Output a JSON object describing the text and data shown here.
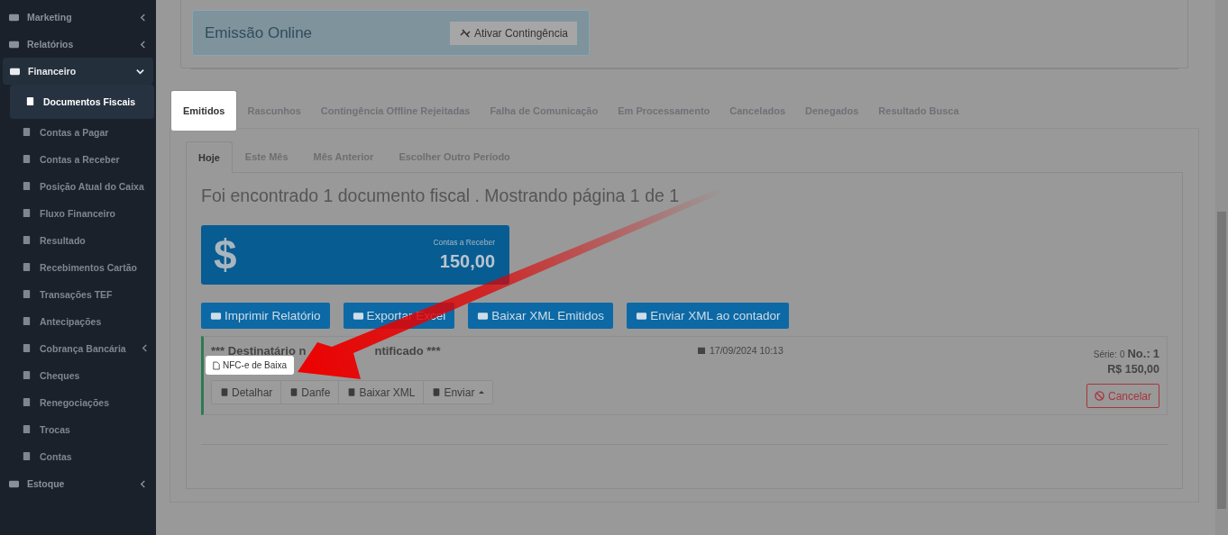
{
  "sidebar": {
    "items": [
      {
        "label": "Marketing",
        "expanded": false
      },
      {
        "label": "Relatórios",
        "expanded": false
      },
      {
        "label": "Financeiro",
        "expanded": true,
        "children": [
          {
            "label": "Documentos Fiscais",
            "kind": "link",
            "selected": true
          },
          {
            "label": "Contas a Pagar",
            "kind": "link",
            "selected": false
          },
          {
            "label": "Contas a Receber",
            "kind": "link",
            "selected": false
          },
          {
            "label": "Posição Atual do Caixa",
            "kind": "link",
            "selected": false
          },
          {
            "label": "Fluxo Financeiro",
            "kind": "link",
            "selected": false
          },
          {
            "label": "Resultado",
            "kind": "link",
            "selected": false
          },
          {
            "label": "Recebimentos Cartão",
            "kind": "link",
            "selected": false
          },
          {
            "label": "Transações TEF",
            "kind": "link",
            "selected": false
          },
          {
            "label": "Antecipações",
            "kind": "link",
            "selected": false
          },
          {
            "label": "Cobrança Bancária",
            "kind": "group",
            "selected": false,
            "expanded": false
          },
          {
            "label": "Cheques",
            "kind": "link",
            "selected": false
          },
          {
            "label": "Renegociações",
            "kind": "link",
            "selected": false
          },
          {
            "label": "Trocas",
            "kind": "link",
            "selected": false
          },
          {
            "label": "Contas",
            "kind": "link",
            "selected": false
          }
        ]
      },
      {
        "label": "Estoque",
        "expanded": false
      }
    ]
  },
  "contingency": {
    "status": "Emissão Online",
    "button": "Ativar Contingência"
  },
  "tabs": [
    {
      "label": "Emitidos",
      "selected": true,
      "highlighted": true
    },
    {
      "label": "Rascunhos",
      "selected": false,
      "highlighted": false
    },
    {
      "label": "Contingência Offline Rejeitadas",
      "selected": false,
      "highlighted": false
    },
    {
      "label": "Falha de Comunicação",
      "selected": false,
      "highlighted": false
    },
    {
      "label": "Em Processamento",
      "selected": false,
      "highlighted": false
    },
    {
      "label": "Cancelados",
      "selected": false,
      "highlighted": false
    },
    {
      "label": "Denegados",
      "selected": false,
      "highlighted": false
    },
    {
      "label": "Resultado Busca",
      "selected": false,
      "highlighted": false
    }
  ],
  "period_tabs": [
    {
      "label": "Hoje",
      "selected": true
    },
    {
      "label": "Este Mês",
      "selected": false
    },
    {
      "label": "Mês Anterior",
      "selected": false
    },
    {
      "label": "Escolher Outro Período",
      "selected": false
    }
  ],
  "summary": "Foi encontrado 1 documento fiscal . Mostrando página 1 de 1",
  "total_card": {
    "symbol": "$",
    "label": "Contas a Receber",
    "value": "150,00"
  },
  "actions": [
    "Imprimir Relatório",
    "Exportar Excel",
    "Baixar XML Emitidos",
    "Enviar XML ao contador"
  ],
  "documents": [
    {
      "recipient_parts": [
        "*** Destinatário n",
        "ntificado ***"
      ],
      "type": "NFC-e de Baixa",
      "highlighted": true,
      "datetime": "17/09/2024 10:13",
      "serie_label": "Série:",
      "serie": "0",
      "number_label": "No.:",
      "number": "1",
      "total": "R$ 150,00",
      "buttons": [
        "Detalhar",
        "Danfe",
        "Baixar XML",
        "Enviar"
      ],
      "cancel": "Cancelar"
    }
  ]
}
